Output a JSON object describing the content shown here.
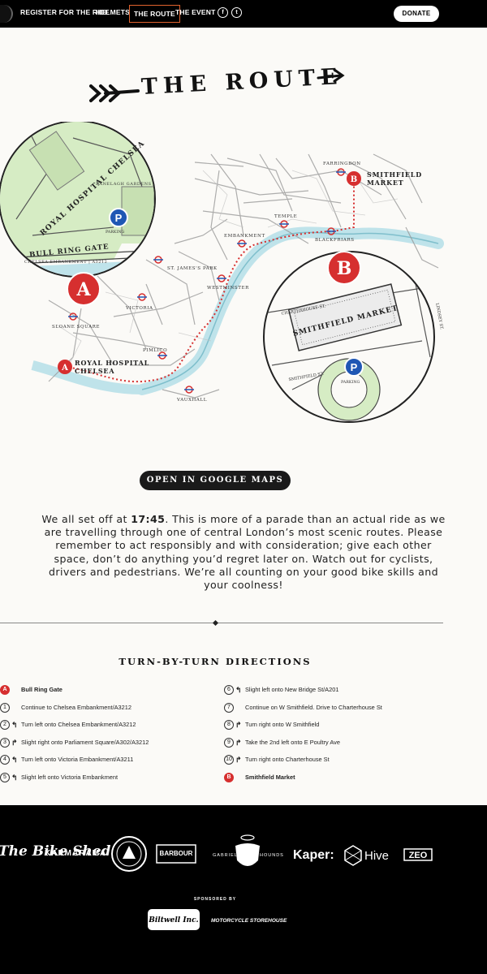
{
  "nav": {
    "items": [
      "REGISTER FOR THE RIDE",
      "HELMETS",
      "THE ROUTE",
      "THE EVENT"
    ],
    "social": [
      "f",
      "t"
    ],
    "donate": "DONATE"
  },
  "page_title": "THE ROUTE",
  "map": {
    "circle_a": {
      "labels": [
        "ROYAL HOSPITAL CHELSEA",
        "RANELAGH GARDENS",
        "BULL RING GATE",
        "CHELSEA EMBANKMENT | A3212",
        "PARKING"
      ],
      "marker": "A",
      "parking": "P"
    },
    "circle_b": {
      "labels": [
        "CHARTERHOUSE ST.",
        "SMITHFIELD MARKET",
        "SMITHFIELD ST.",
        "LINDSEY ST.",
        "PARKING"
      ],
      "marker": "B",
      "parking": "P"
    },
    "stations": [
      "FARRINGDON",
      "TEMPLE",
      "EMBANKMENT",
      "BLACKFRIARS",
      "ST. JAMES'S PARK",
      "WESTMINSTER",
      "VICTORIA",
      "SLOANE SQUARE",
      "PIMLICO",
      "VAUXHALL"
    ],
    "start_label": [
      "ROYAL HOSPITAL",
      "CHELSEA"
    ],
    "end_label": [
      "SMITHFIELD",
      "MARKET"
    ],
    "start_marker": "A",
    "end_marker": "B"
  },
  "gmaps_button": "OPEN IN GOOGLE MAPS",
  "intro": {
    "pre": "We all set off at ",
    "time": "17:45",
    "post": ". This is more of a parade than an actual ride as we are travelling through one of central London’s most scenic routes.  Please remember to act responsibly and with consideration; give each other space, don’t do anything you’d regret later on. Watch out for cyclists, drivers and pedestrians. We’re all counting on your good bike skills and your coolness!"
  },
  "directions": {
    "title": "TURN-BY-TURN DIRECTIONS",
    "left": [
      {
        "n": "A",
        "arrow": "",
        "text": "Bull Ring Gate",
        "red": true
      },
      {
        "n": "1",
        "arrow": "",
        "text": "Continue to Chelsea Embankment/A3212"
      },
      {
        "n": "2",
        "arrow": "↰",
        "text": "Turn left onto Chelsea Embankment/A3212"
      },
      {
        "n": "3",
        "arrow": "↱",
        "text": "Slight right onto Parliament Square/A302/A3212"
      },
      {
        "n": "4",
        "arrow": "↰",
        "text": "Turn left onto Victoria Embankment/A3211"
      },
      {
        "n": "5",
        "arrow": "↰",
        "text": "Slight left onto Victoria Embankment"
      }
    ],
    "right": [
      {
        "n": "6",
        "arrow": "↰",
        "text": "Slight left onto New Bridge St/A201"
      },
      {
        "n": "7",
        "arrow": "",
        "text": "Continue on W Smithfield. Drive to Charterhouse St"
      },
      {
        "n": "8",
        "arrow": "↱",
        "text": "Turn right onto W Smithfield"
      },
      {
        "n": "9",
        "arrow": "↱",
        "text": "Take the 2nd left onto E Poultry Ave"
      },
      {
        "n": "10",
        "arrow": "↱",
        "text": "Turn right onto Charterhouse St"
      },
      {
        "n": "B",
        "arrow": "",
        "text": "Smithfield Market",
        "red": true
      }
    ]
  },
  "footer": {
    "partners": [
      "The Bike Shed",
      "KARMARAMA",
      "BARBOUR",
      "GABRIEL",
      "HOUNDS",
      "Kaper:",
      "Hive",
      "ZEO"
    ],
    "sponsored_by": "SPONSORED BY",
    "sponsors": [
      "Biltwell Inc.",
      "MOTORCYCLE STOREHOUSE"
    ]
  },
  "colors": {
    "accent": "#d62f2f",
    "parking": "#1f57b4",
    "park_green": "#d6ecc4",
    "river": "#bfe3ea",
    "nav_active": "#e0622e"
  }
}
